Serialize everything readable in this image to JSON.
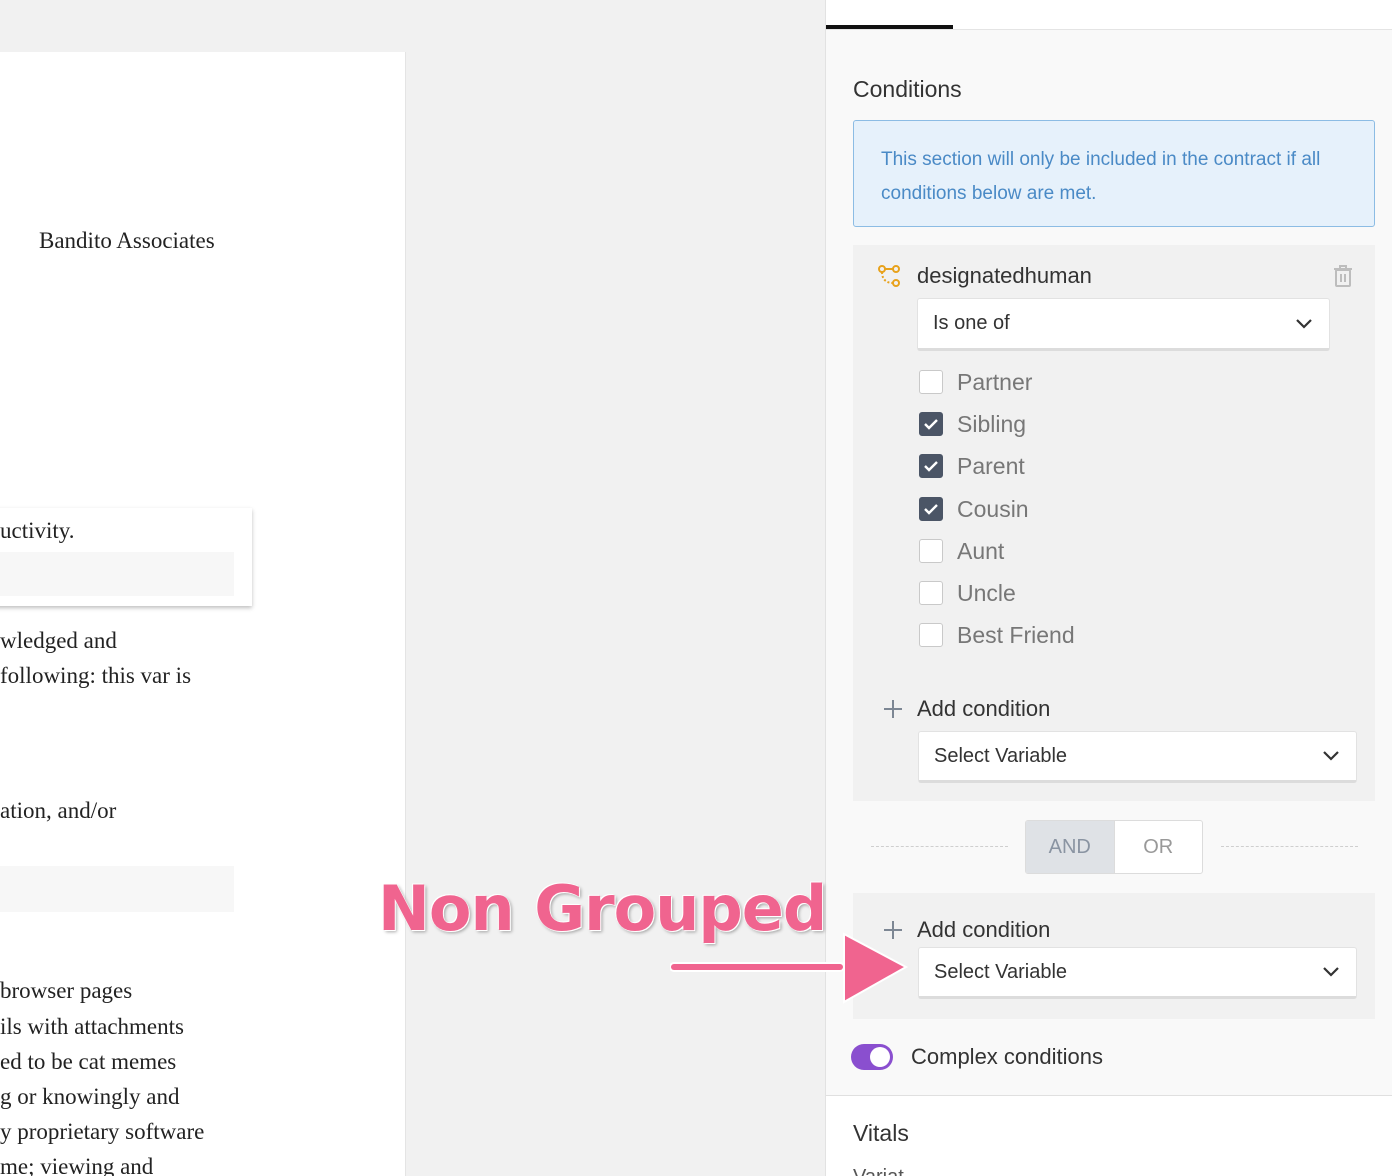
{
  "document": {
    "company": "Bandito Associates",
    "popup_text": "uctivity.",
    "lines": [
      "wledged and",
      "following: this var is",
      "ation, and/or",
      "browser pages",
      "ils with attachments",
      "ed to be cat memes",
      "g or knowingly and",
      "y proprietary software",
      "me; viewing and"
    ]
  },
  "panel": {
    "conditions_title": "Conditions",
    "info_text": "This section will only be included in the contract if all conditions below are met.",
    "condition": {
      "variable": "designatedhuman",
      "operator": "Is one of",
      "options": [
        {
          "label": "Partner",
          "checked": false
        },
        {
          "label": "Sibling",
          "checked": true
        },
        {
          "label": "Parent",
          "checked": true
        },
        {
          "label": "Cousin",
          "checked": true
        },
        {
          "label": "Aunt",
          "checked": false
        },
        {
          "label": "Uncle",
          "checked": false
        },
        {
          "label": "Best Friend",
          "checked": false
        }
      ]
    },
    "add_condition_label": "Add condition",
    "select_variable_placeholder": "Select Variable",
    "and_label": "AND",
    "or_label": "OR",
    "complex_conditions_label": "Complex conditions",
    "complex_conditions_on": true,
    "vitals_title": "Vitals",
    "vitals_sub": "Variat"
  },
  "annotation": {
    "text": "Non Grouped"
  },
  "colors": {
    "accent": "#8a4fcf",
    "info_bg": "#e6f1fb",
    "info_text": "#4a8ac6",
    "annotation": "#f0648f",
    "checkbox_checked": "#4b5566",
    "variable_icon": "#e8a21c"
  }
}
